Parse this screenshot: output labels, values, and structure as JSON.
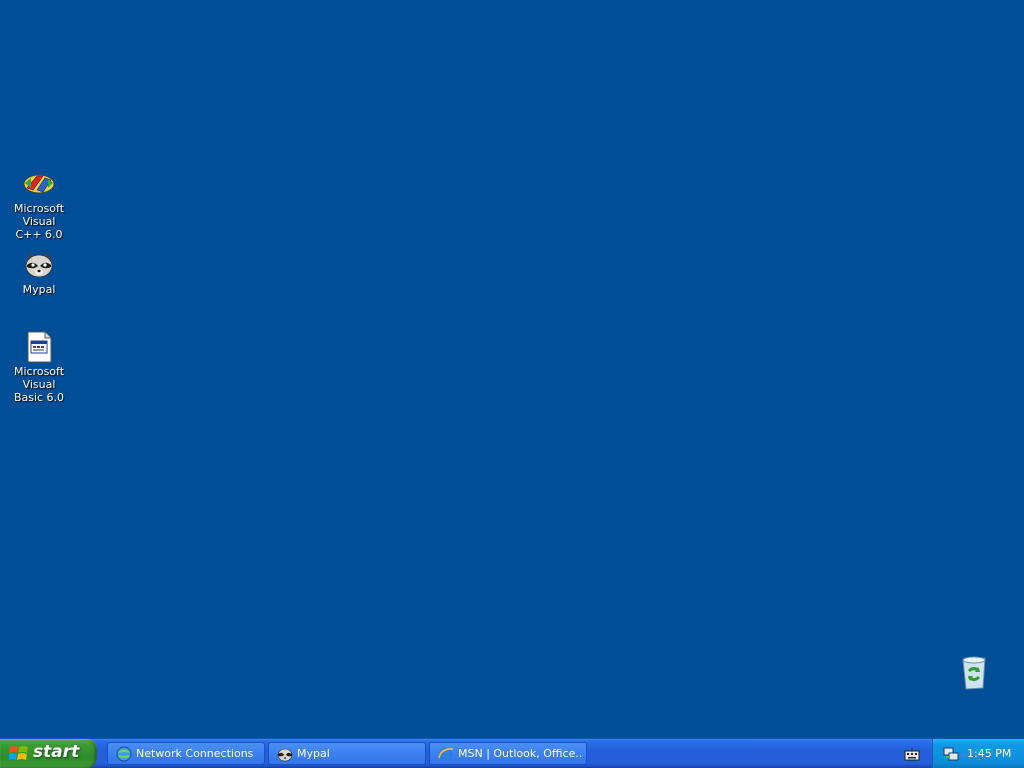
{
  "desktop": {
    "background_color": "#004e98",
    "icons": [
      {
        "label": "Microsoft Visual\nC++ 6.0",
        "icon": "visual-cpp-icon"
      },
      {
        "label": "Mypal",
        "icon": "mypal-raccoon-icon"
      },
      {
        "label": "Microsoft Visual\nBasic 6.0",
        "icon": "visual-basic-icon"
      }
    ],
    "recycle_bin_icon": "recycle-bin-icon"
  },
  "taskbar": {
    "start_label": "start",
    "buttons": [
      {
        "label": "Network Connections",
        "icon": "network-connections-icon"
      },
      {
        "label": "Mypal",
        "icon": "mypal-raccoon-icon"
      },
      {
        "label": "MSN | Outlook, Office...",
        "icon": "internet-explorer-icon"
      }
    ],
    "tray": {
      "clock": "1:45 PM",
      "icons": [
        "keyboard-language-icon",
        "network-status-icon"
      ]
    }
  }
}
